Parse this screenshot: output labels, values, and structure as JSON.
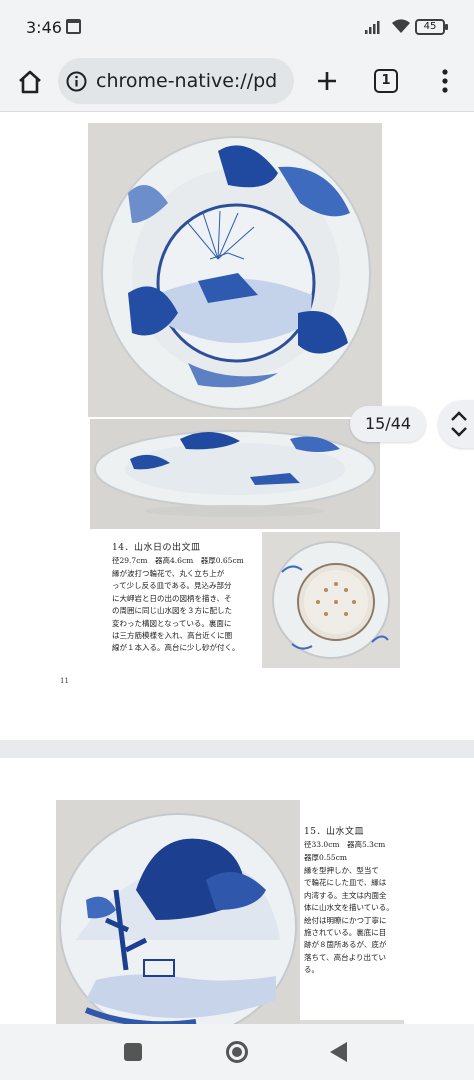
{
  "status_bar": {
    "time": "3:46",
    "battery": "45"
  },
  "browser": {
    "url": "chrome-native://pd",
    "tab_count": "1"
  },
  "pdf": {
    "page_indicator": "15/44",
    "page1": {
      "caption_title": "14．山水日の出文皿",
      "caption_meta": "径29.7cm　器高4.6cm　器厚0.65cm",
      "caption_lines": [
        "縁が波打つ輪花で、丸く立ち上が",
        "って少し反る皿である。見込み部分",
        "に大岬岩と日の出の図柄を描き、そ",
        "の周囲に同じ山水図を３方に配した",
        "変わった構図となっている。裏面に",
        "は三方筋模様を入れ、高台近くに圏",
        "線が１本入る。高台に少し砂が付く。"
      ],
      "page_number": "11"
    },
    "page2": {
      "caption_title": "15．山水文皿",
      "caption_meta": "径33.0cm　器高5.3cm",
      "caption_meta2": "器厚0.55cm",
      "caption_lines": [
        "縁を型押しか、型当て",
        "で輪花にした皿で、縁は",
        "内湾する。主文は内面全",
        "体に山水文を描いている。",
        "絵付は明瞭にかつ丁寧に",
        "施されている。裏底に目",
        "跡が８箇所あるが、底が",
        "落ちて、高台より出てい",
        "る。"
      ]
    }
  }
}
